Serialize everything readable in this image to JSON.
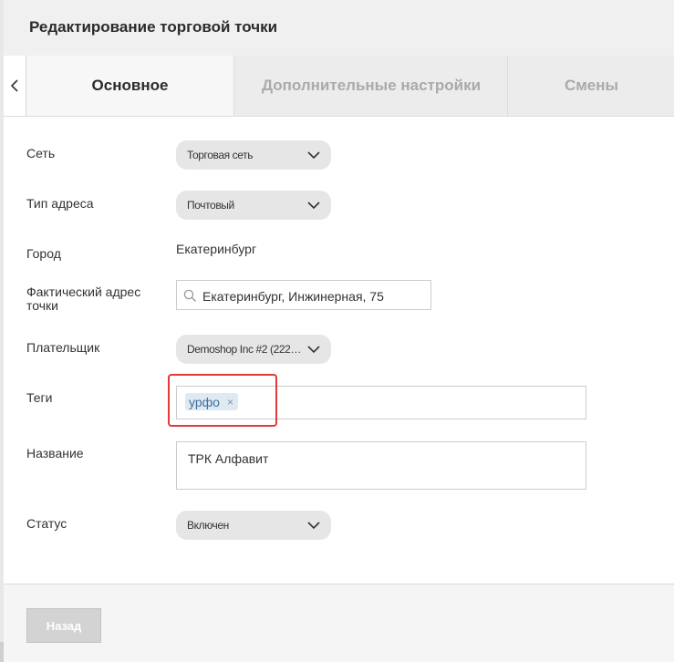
{
  "header": {
    "title": "Редактирование торговой точки"
  },
  "tabs": [
    {
      "label": "Основное",
      "active": true
    },
    {
      "label": "Дополнительные настройки",
      "active": false
    },
    {
      "label": "Смены",
      "active": false
    }
  ],
  "icons": {
    "back": "chevron-left-icon",
    "dropdown": "chevron-down-icon",
    "search": "search-icon",
    "remove": "close-icon"
  },
  "form": {
    "network": {
      "label": "Сеть",
      "value": "Торговая сеть"
    },
    "address_type": {
      "label": "Тип адреса",
      "value": "Почтовый"
    },
    "city": {
      "label": "Город",
      "value": "Екатеринбург"
    },
    "actual_address": {
      "label_line1": "Фактический адрес",
      "label_line2": "точки",
      "value": "Екатеринбург, Инжинерная, 75"
    },
    "payer": {
      "label": "Плательщик",
      "value": "Demoshop Inc #2 (2223…"
    },
    "tags": {
      "label": "Теги",
      "items": [
        {
          "text": "урфо",
          "remove": "×"
        }
      ]
    },
    "name": {
      "label": "Название",
      "value": "ТРК Алфавит"
    },
    "status": {
      "label": "Статус",
      "value": "Включен"
    }
  },
  "footer": {
    "back_button": "Назад"
  },
  "colors": {
    "highlight": "#e03a3a",
    "tag_bg": "#dfe9f2",
    "tag_text": "#3d6f9e",
    "select_bg": "#e6e6e6"
  }
}
